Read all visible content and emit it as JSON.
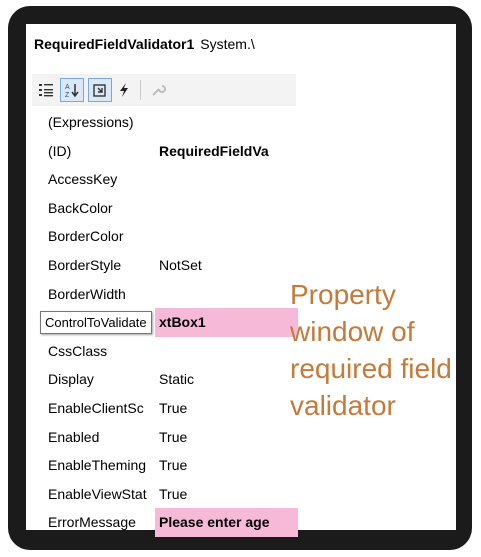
{
  "properties_window": {
    "object_name": "RequiredFieldValidator1",
    "object_type": "System.\\",
    "toolbar": [
      {
        "icon": "categorized-icon"
      },
      {
        "icon": "alphabetical-sort-icon"
      },
      {
        "icon": "properties-icon"
      },
      {
        "icon": "events-lightning-icon"
      },
      {
        "icon": "property-pages-wrench-icon"
      }
    ],
    "rows": [
      {
        "name": "(Expressions)",
        "value": ""
      },
      {
        "name": "(ID)",
        "value": "RequiredFieldVa"
      },
      {
        "name": "AccessKey",
        "value": ""
      },
      {
        "name": "BackColor",
        "value": ""
      },
      {
        "name": "BorderColor",
        "value": ""
      },
      {
        "name": "BorderStyle",
        "value": "NotSet"
      },
      {
        "name": "BorderWidth",
        "value": ""
      },
      {
        "name": "ControlToValidate",
        "value": "xtBox1"
      },
      {
        "name": "CssClass",
        "value": ""
      },
      {
        "name": "Display",
        "value": "Static"
      },
      {
        "name": "EnableClientSc",
        "value": "True"
      },
      {
        "name": "Enabled",
        "value": "True"
      },
      {
        "name": "EnableTheming",
        "value": "True"
      },
      {
        "name": "EnableViewStat",
        "value": "True"
      },
      {
        "name": "ErrorMessage",
        "value": "Please enter age"
      }
    ],
    "tooltip": "ControlToValidate"
  },
  "caption": "Property window of required field validator",
  "colors": {
    "highlight": "#f6b9d8",
    "caption": "#c47a3a",
    "frame": "#1b1b1b"
  }
}
